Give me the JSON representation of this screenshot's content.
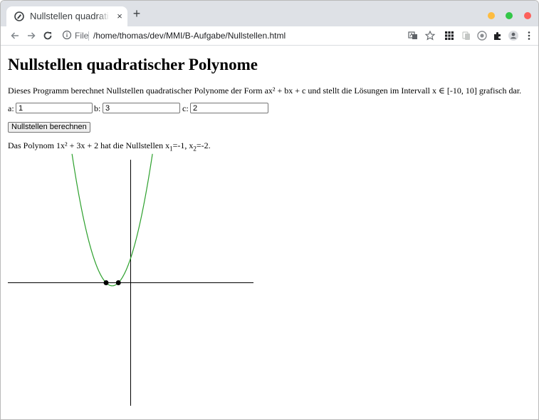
{
  "browser": {
    "tab_title": "Nullstellen quadratischer Polynome",
    "tab_close_glyph": "×",
    "new_tab_glyph": "+",
    "file_label": "File",
    "url": "/home/thomas/dev/MMI/B-Aufgabe/Nullstellen.html",
    "icons": [
      "globe-icon",
      "back-icon",
      "forward-icon",
      "reload-icon",
      "info-icon",
      "translate-icon",
      "star-icon",
      "apps-icon",
      "extension-icon",
      "profile-icon",
      "menu-icon"
    ],
    "colors": {
      "tabstrip": "#dee1e6",
      "min": "#fdbc40",
      "max": "#33c748",
      "close": "#fc605b"
    }
  },
  "page": {
    "title": "Nullstellen quadratischer Polynome",
    "description": "Dieses Programm berechnet Nullstellen quadratischer Polynome der Form ax² + bx + c und stellt die Lösungen im Intervall x ∈ [-10, 10] grafisch dar.",
    "inputs": {
      "a": {
        "label": "a:",
        "value": "1"
      },
      "b": {
        "label": "b:",
        "value": "3"
      },
      "c": {
        "label": "c:",
        "value": "2"
      }
    },
    "button_label": "Nullstellen berechnen",
    "result": {
      "prefix": "Das Polynom 1x² + 3x + 2 hat die Nullstellen x",
      "sub1": "1",
      "mid": "=-1, x",
      "sub2": "2",
      "suffix": "=-2."
    }
  },
  "chart_data": {
    "type": "line",
    "function": "1x² + 3x + 2",
    "coefficients": {
      "a": 1,
      "b": 3,
      "c": 2
    },
    "xlim": [
      -10,
      10
    ],
    "ylim": [
      -10,
      10
    ],
    "roots": [
      -1,
      -2
    ],
    "curve_color": "#2ca02c",
    "axis_color": "#000000",
    "root_marker_color": "#000000",
    "grid": false
  }
}
